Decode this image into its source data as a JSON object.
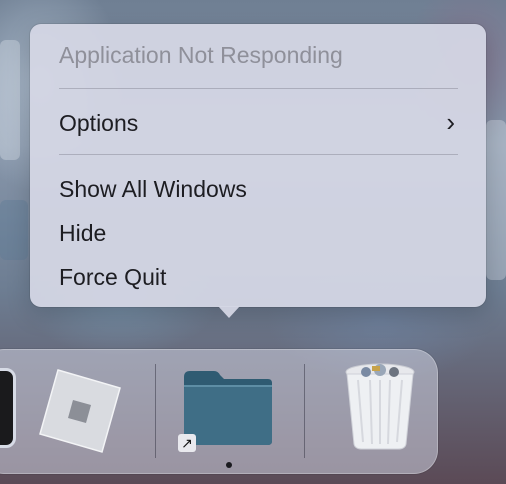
{
  "context_menu": {
    "title": "Application Not Responding",
    "items": [
      {
        "label": "Options",
        "has_submenu": true
      },
      {
        "label": "Show All Windows"
      },
      {
        "label": "Hide"
      },
      {
        "label": "Force Quit"
      }
    ]
  },
  "dock": {
    "apps": [
      {
        "icon": "dark-app-icon"
      },
      {
        "icon": "roblox-icon"
      },
      {
        "icon": "folder-icon",
        "alias": true,
        "running": true
      },
      {
        "icon": "trash-icon"
      }
    ]
  },
  "colors": {
    "menu_background": "#d5d7e4",
    "title_text": "#8f909a",
    "item_text": "#1d1d22",
    "folder_blue": "#3f6e86"
  }
}
